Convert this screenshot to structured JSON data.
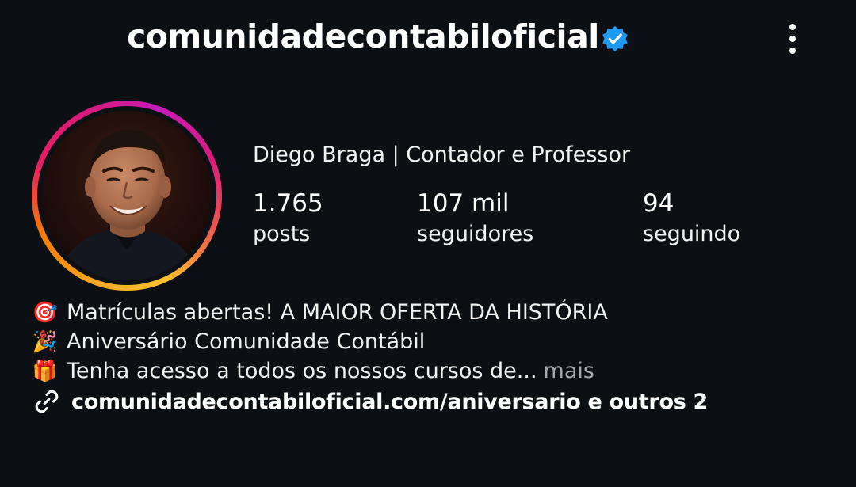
{
  "header": {
    "username": "comunidadecontabiloficial",
    "verified_icon": "verified-badge-icon",
    "menu_icon": "more-vertical-icon",
    "accent_color": "#1d9bf0"
  },
  "profile": {
    "full_name": "Diego Braga | Contador e Professor",
    "avatar": "profile-photo"
  },
  "stats": {
    "posts": {
      "value": "1.765",
      "label": "posts"
    },
    "followers": {
      "value": "107 mil",
      "label": "seguidores"
    },
    "following": {
      "value": "94",
      "label": "seguindo"
    }
  },
  "bio": {
    "line1": {
      "emoji": "🎯",
      "text": "Matrículas abertas! A MAIOR OFERTA DA HISTÓRIA"
    },
    "line2": {
      "emoji": "🎉",
      "text": "Aniversário Comunidade Contábil"
    },
    "line3": {
      "emoji": "🎁",
      "text": "Tenha acesso a todos os nossos cursos de...",
      "more": "mais"
    }
  },
  "link": {
    "icon": "link-icon",
    "text": "comunidadecontabiloficial.com/aniversario e outros 2"
  }
}
